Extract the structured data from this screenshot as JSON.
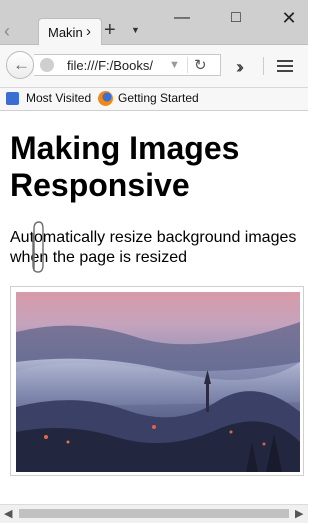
{
  "window": {
    "minimize_icon": "minimize-icon",
    "maximize_icon": "maximize-icon",
    "close_icon": "close-icon"
  },
  "tab": {
    "title": "Making Images Responsive",
    "title_visible": "Makin",
    "new_tab_glyph": "+"
  },
  "navbar": {
    "url": "file:///F:/Books/",
    "back_icon": "back-arrow-icon",
    "reload_icon": "reload-icon",
    "overflow_icon": "overflow-chevron-icon",
    "menu_icon": "hamburger-menu-icon"
  },
  "bookmarks": [
    {
      "label": "Most Visited",
      "icon": "bookmark-icon"
    },
    {
      "label": "Getting Started",
      "icon": "firefox-icon"
    }
  ],
  "page": {
    "heading": "Making Images Responsive",
    "paragraph": "Automatically resize background images when the page is resized"
  },
  "colors": {
    "titlebar": "#cfcfcf",
    "toolbar": "#f7f7f7",
    "scroll_thumb": "#c1c1c1"
  }
}
